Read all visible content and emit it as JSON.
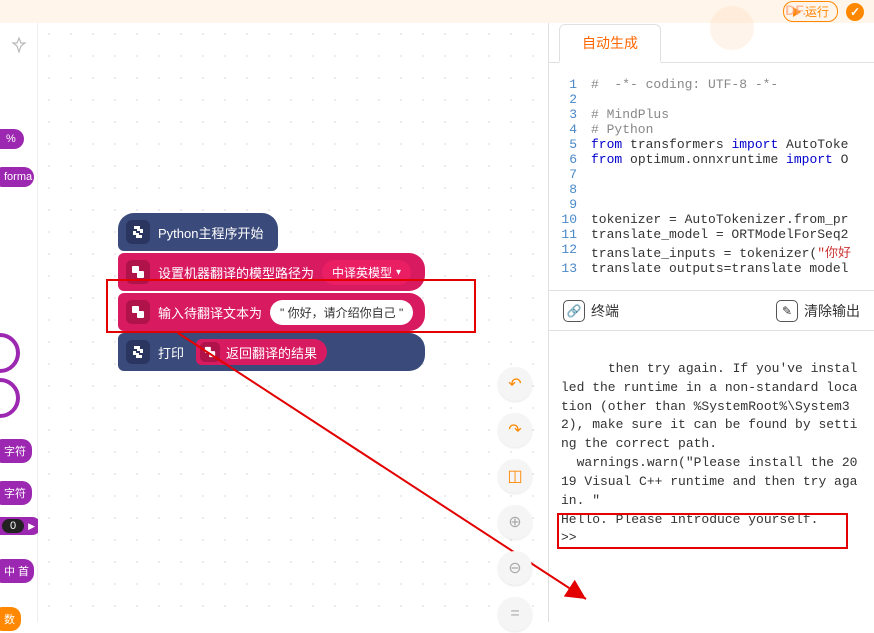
{
  "topbar": {
    "run_label": "运行",
    "brand": "DF..."
  },
  "rail": {
    "pct": "%",
    "forma": "forma",
    "t1": "字符",
    "t2": "字符",
    "num": "0",
    "t3": "中 首",
    "t4": "数"
  },
  "blocks": {
    "start": "Python主程序开始",
    "l1_label": "设置机器翻译的模型路径为",
    "l1_sel": "中译英模型",
    "l2_label": "输入待翻译文本为",
    "l2_val": "\" 你好，请介绍你自己 \"",
    "l3_label": "打印",
    "l3_sub": "返回翻译的结果"
  },
  "tabs": {
    "auto": "自动生成"
  },
  "code": {
    "lines": [
      {
        "n": 1,
        "type": "cm",
        "t": "#  -*- coding: UTF-8 -*-"
      },
      {
        "n": 2,
        "type": "",
        "t": ""
      },
      {
        "n": 3,
        "type": "cm",
        "t": "# MindPlus"
      },
      {
        "n": 4,
        "type": "cm",
        "t": "# Python"
      },
      {
        "n": 5,
        "type": "from1",
        "a": "from ",
        "b": "transformers ",
        "c": "import ",
        "d": "AutoToke"
      },
      {
        "n": 6,
        "type": "from1",
        "a": "from ",
        "b": "optimum.onnxruntime ",
        "c": "import ",
        "d": "O"
      },
      {
        "n": 7,
        "type": "",
        "t": ""
      },
      {
        "n": 8,
        "type": "",
        "t": ""
      },
      {
        "n": 9,
        "type": "",
        "t": ""
      },
      {
        "n": 10,
        "type": "",
        "t": "tokenizer = AutoTokenizer.from_pr"
      },
      {
        "n": 11,
        "type": "",
        "t": "translate_model = ORTModelForSeq2"
      },
      {
        "n": 12,
        "type": "str1",
        "a": "translate_inputs = tokenizer(",
        "b": "\"你好"
      },
      {
        "n": 13,
        "type": "",
        "t": "translate outputs=translate model"
      }
    ]
  },
  "terminal": {
    "head": "终端",
    "clear": "清除输出",
    "body": "then try again. If you've installed the runtime in a non-standard location (other than %SystemRoot%\\System32), make sure it can be found by setting the correct path.\n  warnings.warn(\"Please install the 2019 Visual C++ runtime and then try again. \"\nHello. Please introduce yourself.\n>>"
  }
}
